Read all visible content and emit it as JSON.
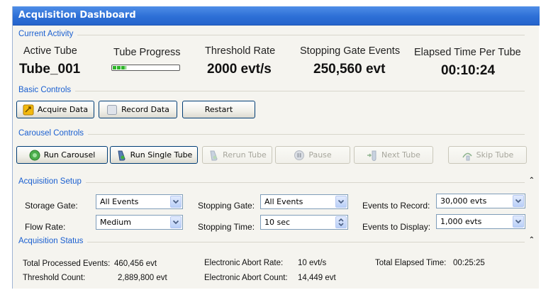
{
  "window": {
    "title": "Acquisition Dashboard"
  },
  "current_activity": {
    "section_label": "Current Activity",
    "active_tube": {
      "label": "Active Tube",
      "value": "Tube_001"
    },
    "tube_progress": {
      "label": "Tube Progress",
      "percent": 20
    },
    "threshold_rate": {
      "label": "Threshold Rate",
      "value": "2000 evt/s"
    },
    "stopping_gate_events": {
      "label": "Stopping Gate Events",
      "value": "250,560 evt"
    },
    "elapsed_time_per_tube": {
      "label": "Elapsed Time Per Tube",
      "value": "00:10:24"
    }
  },
  "basic_controls": {
    "section_label": "Basic Controls",
    "acquire_label": "Acquire Data",
    "record_label": "Record Data",
    "restart_label": "Restart"
  },
  "carousel_controls": {
    "section_label": "Carousel Controls",
    "run_carousel_label": "Run Carousel",
    "run_single_label": "Run Single Tube",
    "rerun_label": "Rerun Tube",
    "pause_label": "Pause",
    "next_label": "Next Tube",
    "skip_label": "Skip Tube"
  },
  "acquisition_setup": {
    "section_label": "Acquisition Setup",
    "storage_gate": {
      "label": "Storage Gate:",
      "value": "All Events"
    },
    "flow_rate": {
      "label": "Flow Rate:",
      "value": "Medium"
    },
    "stopping_gate": {
      "label": "Stopping Gate:",
      "value": "All Events"
    },
    "stopping_time": {
      "label": "Stopping Time:",
      "value": "10 sec"
    },
    "events_to_record": {
      "label": "Events to Record:",
      "value": "30,000 evts"
    },
    "events_to_display": {
      "label": "Events to Display:",
      "value": "1,000 evts"
    }
  },
  "acquisition_status": {
    "section_label": "Acquisition Status",
    "total_processed": {
      "label": "Total Processed Events:",
      "value": "460,456 evt"
    },
    "threshold_count": {
      "label": "Threshold Count:",
      "value": "2,889,800 evt"
    },
    "abort_rate": {
      "label": "Electronic Abort Rate:",
      "value": "10 evt/s"
    },
    "abort_count": {
      "label": "Electronic Abort Count:",
      "value": "14,449 evt"
    },
    "total_elapsed": {
      "label": "Total Elapsed Time:",
      "value": "00:25:25"
    }
  },
  "colors": {
    "title_bar": "#2d6fd6",
    "section_label": "#1a5fd0",
    "panel_bg": "#f5f4ef"
  }
}
